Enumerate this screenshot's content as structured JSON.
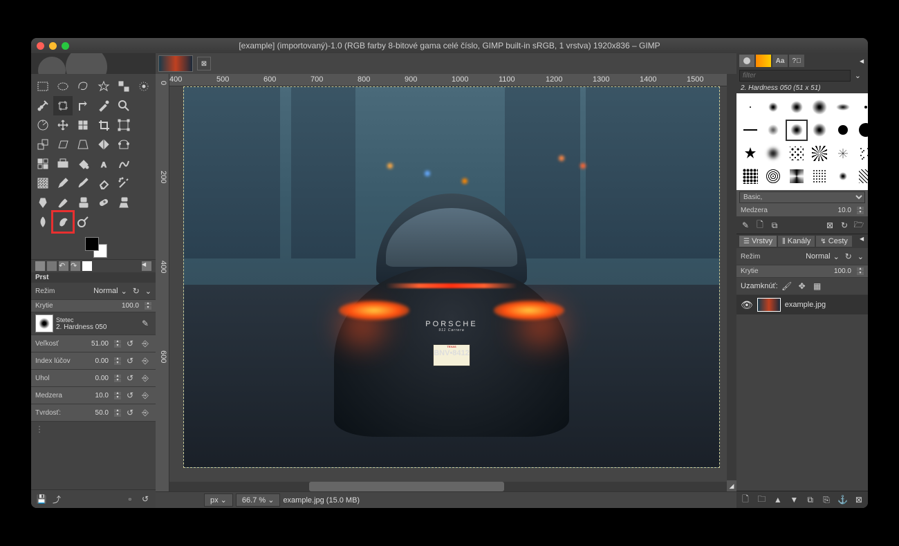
{
  "title": "[example] (importovaný)-1.0 (RGB farby 8-bitové gama celé číslo, GIMP built-in sRGB, 1 vrstva) 1920x836 – GIMP",
  "traffic": {
    "close": "#ff5f57",
    "min": "#febc2e",
    "max": "#28c840"
  },
  "ruler_marks": [
    "400",
    "500",
    "600",
    "700",
    "800",
    "900",
    "1000",
    "1100",
    "1200",
    "1300",
    "1400",
    "1500"
  ],
  "vruler_marks": [
    "0",
    "200",
    "400",
    "600"
  ],
  "toolopt": {
    "title": "Prst",
    "mode_label": "Režim",
    "mode_value": "Normal",
    "opacity_label": "Krytie",
    "opacity_value": "100.0",
    "brush_label": "Stetec",
    "brush_name": "2. Hardness 050",
    "rows": [
      {
        "label": "Veľkosť",
        "value": "51.00"
      },
      {
        "label": "Index lúčov",
        "value": "0.00"
      },
      {
        "label": "Uhol",
        "value": "0.00"
      },
      {
        "label": "Medzera",
        "value": "10.0"
      },
      {
        "label": "Tvrdosť:",
        "value": "50.0"
      }
    ]
  },
  "status": {
    "unit": "px",
    "zoom": "66.7 %",
    "file": "example.jpg (15.0 MB)"
  },
  "right": {
    "filter_ph": "filter",
    "brush_title": "2. Hardness 050 (51 x 51)",
    "preset": "Basic,",
    "spacing_label": "Medzera",
    "spacing_value": "10.0",
    "layers_tab": "Vrstvy",
    "channels_tab": "Kanály",
    "paths_tab": "Cesty",
    "mode_label": "Režim",
    "mode_value": "Normal",
    "opacity_label": "Krytie",
    "opacity_value": "100.0",
    "lock_label": "Uzamknúť:",
    "layer_name": "example.jpg"
  },
  "car": {
    "brand": "PORSCHE",
    "model": "911 Carrera",
    "plate_state": "TEXAS",
    "plate_no": "BNV•8412"
  }
}
